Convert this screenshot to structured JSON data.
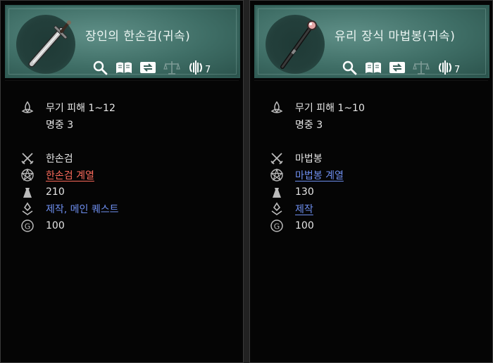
{
  "left_item": {
    "title": "장인의 한손검(귀속)",
    "stat_count": "7",
    "damage": "무기 피해 1~12",
    "accuracy": "명중 3",
    "weapon_type": "한손검",
    "series_link": "한손검 계열",
    "weight": "210",
    "source_link": "제작, 메인 퀘스트",
    "price": "100",
    "series_color": "#ff6b5c"
  },
  "right_item": {
    "title": "유리 장식 마법봉(귀속)",
    "stat_count": "7",
    "damage": "무기 피해 1~10",
    "accuracy": "명중 3",
    "weapon_type": "마법봉",
    "series_link": "마법봉 계열",
    "weight": "130",
    "source_link": "제작",
    "price": "100",
    "series_color": "#6e8ff0"
  },
  "toolbar_icons": [
    "search-icon",
    "book-icon",
    "swap-icon",
    "scale-icon",
    "emblem-icon"
  ],
  "row_icons": [
    "triquetra-icon",
    "crossed-swords-icon",
    "pentagram-icon",
    "weight-icon",
    "crafting-icon",
    "coin-icon"
  ],
  "colors": {
    "header_teal": "#3f6e66",
    "background": "#050505",
    "link_blue": "#6e8ff0",
    "link_red": "#ff6b5c"
  }
}
